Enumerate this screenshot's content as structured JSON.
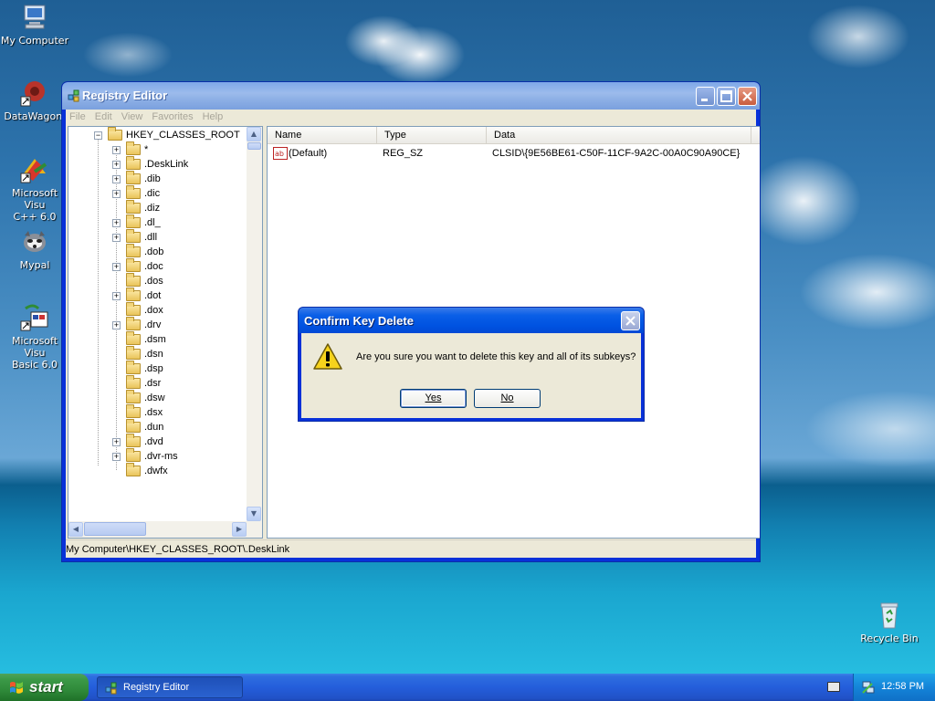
{
  "desktop": {
    "icons": [
      {
        "id": "my-computer",
        "label": "My Computer"
      },
      {
        "id": "datawagon",
        "label": "DataWagon."
      },
      {
        "id": "msvc",
        "label": "Microsoft Visu\nC++ 6.0"
      },
      {
        "id": "mypal",
        "label": "Mypal"
      },
      {
        "id": "msvb",
        "label": "Microsoft Visu\nBasic 6.0"
      },
      {
        "id": "recycle-bin",
        "label": "Recycle Bin"
      }
    ]
  },
  "window": {
    "title": "Registry Editor",
    "menu": [
      "File",
      "Edit",
      "View",
      "Favorites",
      "Help"
    ],
    "tree": {
      "root": "HKEY_CLASSES_ROOT",
      "items": [
        {
          "label": "*",
          "expandable": true
        },
        {
          "label": ".DeskLink",
          "expandable": true,
          "open": true
        },
        {
          "label": ".dib",
          "expandable": true
        },
        {
          "label": ".dic",
          "expandable": true
        },
        {
          "label": ".diz",
          "expandable": false
        },
        {
          "label": ".dl_",
          "expandable": true
        },
        {
          "label": ".dll",
          "expandable": true
        },
        {
          "label": ".dob",
          "expandable": false
        },
        {
          "label": ".doc",
          "expandable": true
        },
        {
          "label": ".dos",
          "expandable": false
        },
        {
          "label": ".dot",
          "expandable": true
        },
        {
          "label": ".dox",
          "expandable": false
        },
        {
          "label": ".drv",
          "expandable": true
        },
        {
          "label": ".dsm",
          "expandable": false
        },
        {
          "label": ".dsn",
          "expandable": false
        },
        {
          "label": ".dsp",
          "expandable": false
        },
        {
          "label": ".dsr",
          "expandable": false
        },
        {
          "label": ".dsw",
          "expandable": false
        },
        {
          "label": ".dsx",
          "expandable": false
        },
        {
          "label": ".dun",
          "expandable": false
        },
        {
          "label": ".dvd",
          "expandable": true
        },
        {
          "label": ".dvr-ms",
          "expandable": true
        },
        {
          "label": ".dwfx",
          "expandable": false
        }
      ]
    },
    "list": {
      "columns": [
        "Name",
        "Type",
        "Data"
      ],
      "rows": [
        {
          "name": "(Default)",
          "type": "REG_SZ",
          "data": "CLSID\\{9E56BE61-C50F-11CF-9A2C-00A0C90A90CE}"
        }
      ]
    },
    "status": "My Computer\\HKEY_CLASSES_ROOT\\.DeskLink"
  },
  "dialog": {
    "title": "Confirm Key Delete",
    "message": "Are you sure you want to delete this key and all of its subkeys?",
    "yes": "Yes",
    "no": "No"
  },
  "taskbar": {
    "start": "start",
    "task": "Registry Editor",
    "clock": "12:58 PM"
  }
}
